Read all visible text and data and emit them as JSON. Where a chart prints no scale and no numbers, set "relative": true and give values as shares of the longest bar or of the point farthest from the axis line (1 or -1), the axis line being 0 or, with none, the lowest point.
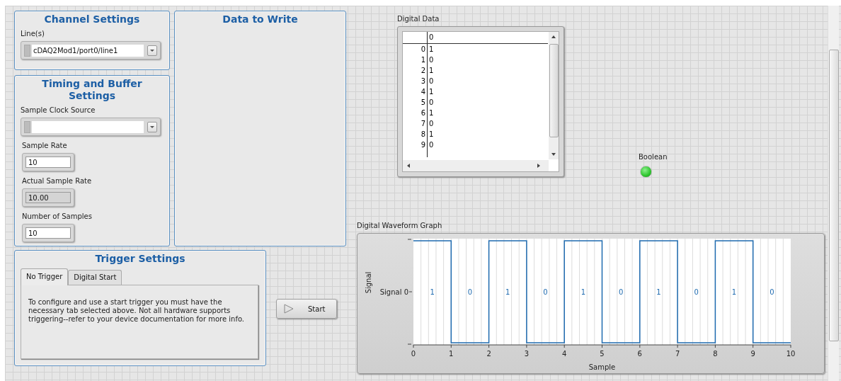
{
  "channel_settings": {
    "title": "Channel Settings",
    "lines_label": "Line(s)",
    "lines_value": "cDAQ2Mod1/port0/line1"
  },
  "data_to_write": {
    "title": "Data to Write"
  },
  "timing": {
    "title": "Timing and Buffer Settings",
    "clock_label": "Sample Clock Source",
    "rate_label": "Sample Rate",
    "rate_value": "10",
    "actual_label": "Actual Sample Rate",
    "actual_value": "10.00",
    "samples_label": "Number of Samples",
    "samples_value": "10"
  },
  "trigger": {
    "title": "Trigger Settings",
    "tabs": [
      {
        "label": "No Trigger",
        "selected": true
      },
      {
        "label": "Digital Start",
        "selected": false
      }
    ],
    "text": "To configure and use a start trigger you must have the necessary tab selected above.  Not all hardware supports triggering--refer to your device documentation for more info."
  },
  "start_button": {
    "label": "Start"
  },
  "digital_data": {
    "label": "Digital Data",
    "column_header": "0",
    "rows": [
      {
        "index": "0",
        "value": "1"
      },
      {
        "index": "1",
        "value": "0"
      },
      {
        "index": "2",
        "value": "1"
      },
      {
        "index": "3",
        "value": "0"
      },
      {
        "index": "4",
        "value": "1"
      },
      {
        "index": "5",
        "value": "0"
      },
      {
        "index": "6",
        "value": "1"
      },
      {
        "index": "7",
        "value": "0"
      },
      {
        "index": "8",
        "value": "1"
      },
      {
        "index": "9",
        "value": "0"
      }
    ]
  },
  "boolean": {
    "label": "Boolean",
    "on": true
  },
  "graph": {
    "label": "Digital Waveform Graph",
    "chart_data": {
      "type": "line",
      "xlabel": "Sample",
      "x": [
        0,
        1,
        1,
        2,
        2,
        3,
        3,
        4,
        4,
        5,
        5,
        6,
        6,
        7,
        7,
        8,
        8,
        9,
        9,
        10
      ],
      "series": [
        {
          "name": "Signal 0",
          "color": "#1f6bb0",
          "values": [
            1,
            1,
            0,
            0,
            1,
            1,
            0,
            0,
            1,
            1,
            0,
            0,
            1,
            1,
            0,
            0,
            1,
            1,
            0,
            0
          ]
        }
      ],
      "xlim": [
        0,
        10
      ],
      "relative": true,
      "grid": true,
      "annotations": [
        {
          "text": "Signal"
        }
      ],
      "xticks": [
        0,
        1,
        2,
        3,
        4,
        5,
        6,
        7,
        8,
        9,
        10
      ],
      "value_labels": [
        "1",
        "0",
        "1",
        "0",
        "1",
        "0",
        "1",
        "0",
        "1",
        "0"
      ]
    }
  }
}
